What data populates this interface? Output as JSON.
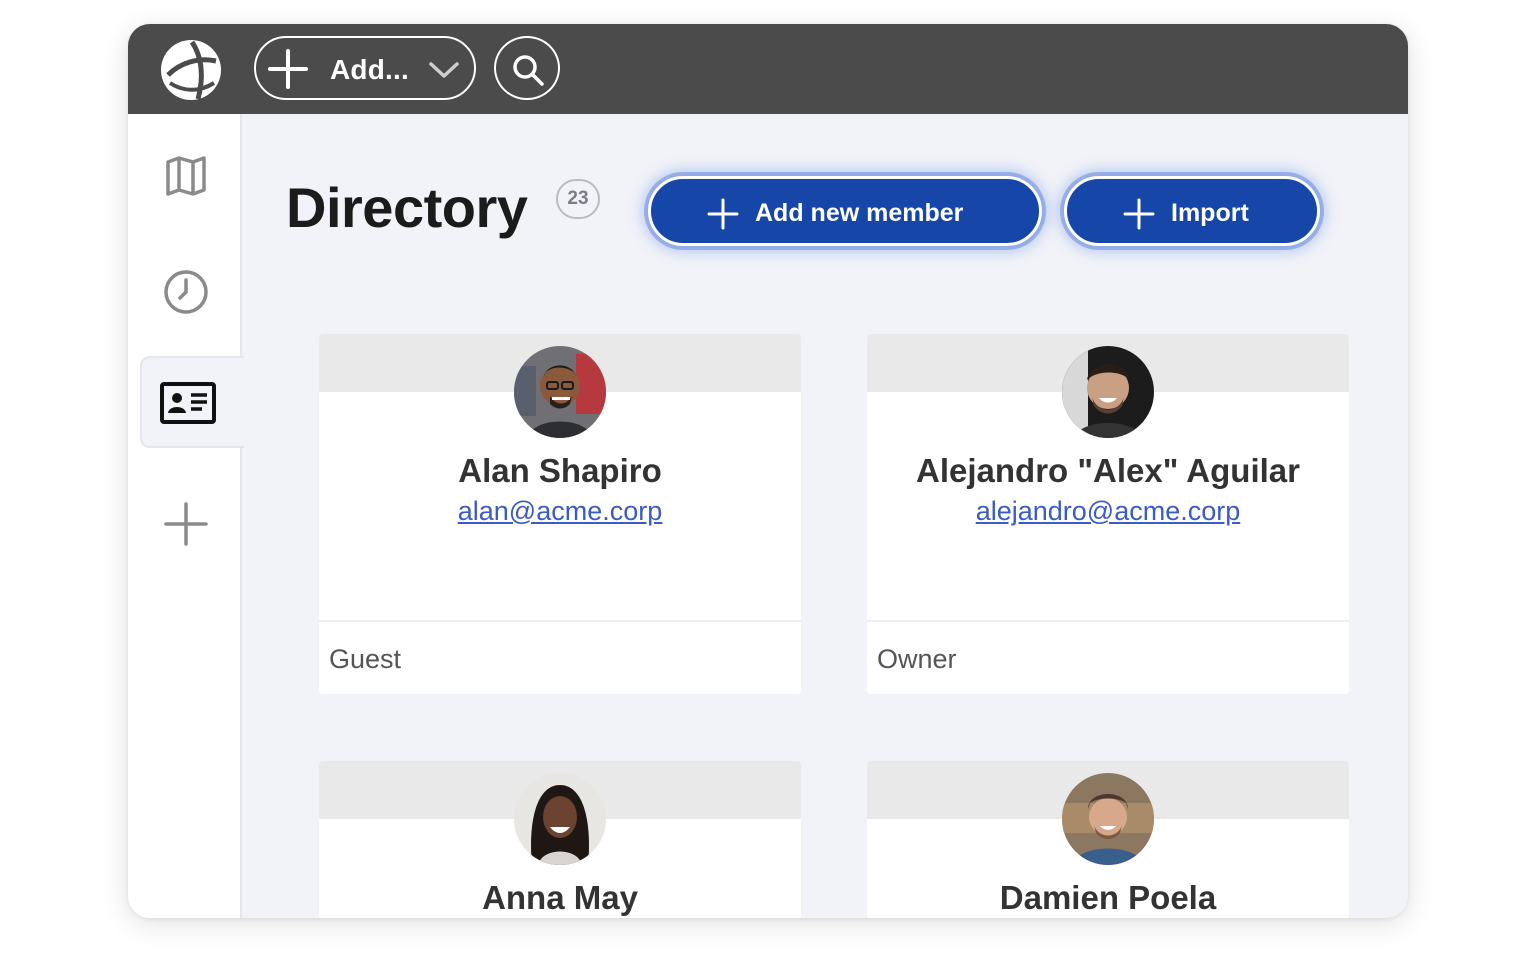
{
  "topbar": {
    "add_label": "Add...",
    "logo_icon": "globe-logo-icon",
    "search_icon": "search-icon"
  },
  "sidebar": {
    "items": [
      {
        "icon": "map-icon",
        "active": false
      },
      {
        "icon": "clock-icon",
        "active": false
      },
      {
        "icon": "id-card-icon",
        "active": true
      },
      {
        "icon": "plus-icon",
        "active": false
      }
    ]
  },
  "header": {
    "title": "Directory",
    "count": "23",
    "add_member_label": "Add new member",
    "import_label": "Import"
  },
  "members": [
    {
      "name": "Alan Shapiro",
      "email": "alan@acme.corp",
      "role": "Guest"
    },
    {
      "name": "Alejandro \"Alex\" Aguilar",
      "email": "alejandro@acme.corp",
      "role": "Owner"
    },
    {
      "name": "Anna May",
      "email": "",
      "role": ""
    },
    {
      "name": "Damien Poela",
      "email": "",
      "role": ""
    }
  ],
  "colors": {
    "topbar": "#4b4b4b",
    "primary": "#1546a8",
    "link": "#3b5cc4",
    "background": "#f2f3f8"
  }
}
